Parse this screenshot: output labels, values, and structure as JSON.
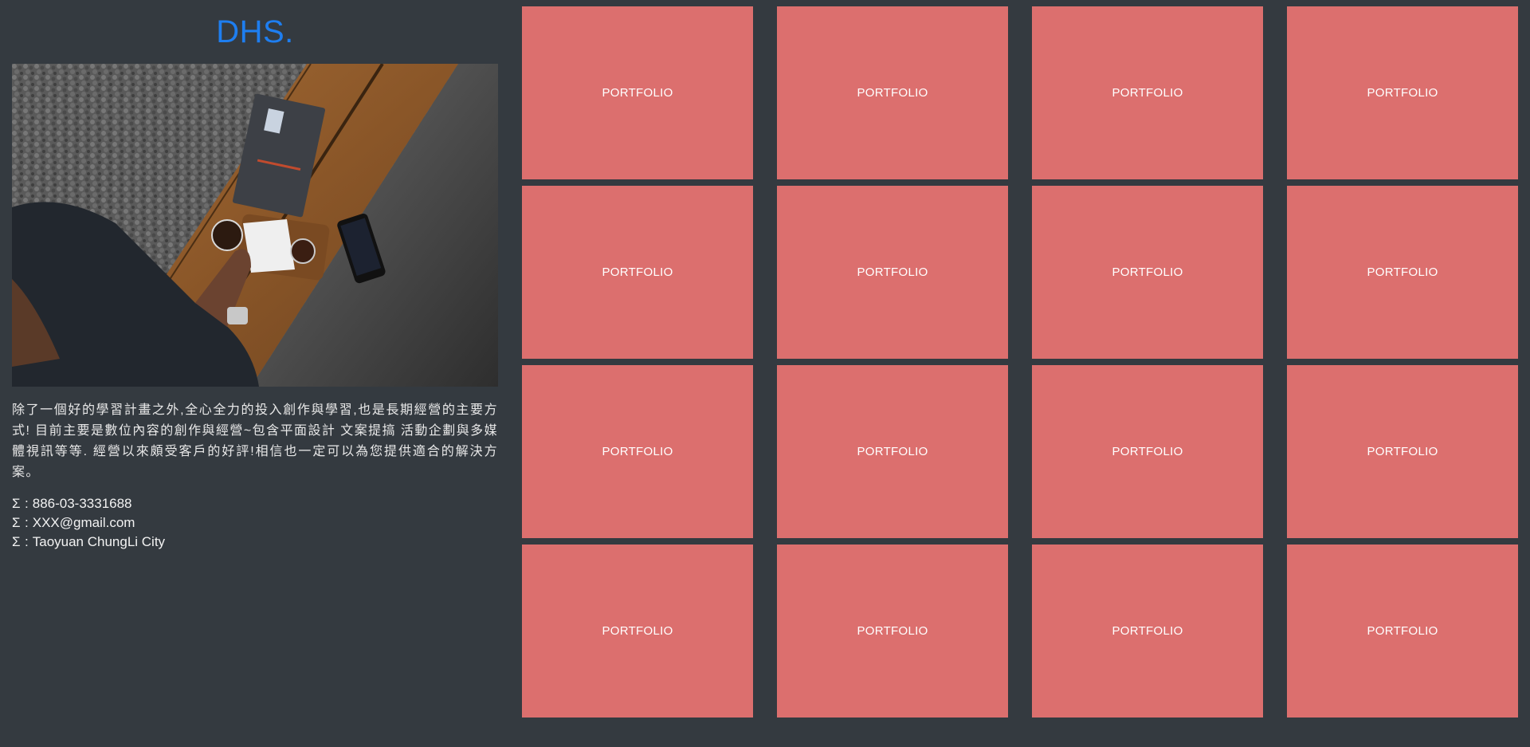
{
  "brand": {
    "logo_text": "DHS."
  },
  "sidebar": {
    "intro": "除了一個好的學習計畫之外,全心全力的投入創作與學習,也是長期經營的主要方式! 目前主要是數位內容的創作與經營~包含平面設計 文案提搞 活動企劃與多媒體視訊等等. 經營以來頗受客戶的好評!相信也一定可以為您提供適合的解決方案。",
    "contacts": [
      {
        "icon": "Σ",
        "icon_name": "phone-icon",
        "value": "886-03-3331688"
      },
      {
        "icon": "Σ",
        "icon_name": "email-icon",
        "value": "XXX@gmail.com"
      },
      {
        "icon": "Σ",
        "icon_name": "location-icon",
        "value": "Taoyuan ChungLi City"
      }
    ],
    "separator": ":"
  },
  "portfolio": {
    "tiles": [
      {
        "label": "PORTFOLIO"
      },
      {
        "label": "PORTFOLIO"
      },
      {
        "label": "PORTFOLIO"
      },
      {
        "label": "PORTFOLIO"
      },
      {
        "label": "PORTFOLIO"
      },
      {
        "label": "PORTFOLIO"
      },
      {
        "label": "PORTFOLIO"
      },
      {
        "label": "PORTFOLIO"
      },
      {
        "label": "PORTFOLIO"
      },
      {
        "label": "PORTFOLIO"
      },
      {
        "label": "PORTFOLIO"
      },
      {
        "label": "PORTFOLIO"
      },
      {
        "label": "PORTFOLIO"
      },
      {
        "label": "PORTFOLIO"
      },
      {
        "label": "PORTFOLIO"
      },
      {
        "label": "PORTFOLIO"
      }
    ]
  },
  "colors": {
    "background": "#343a40",
    "brand": "#1e7ef0",
    "tile": "#dc6f6e",
    "text": "#e8e8e8"
  }
}
